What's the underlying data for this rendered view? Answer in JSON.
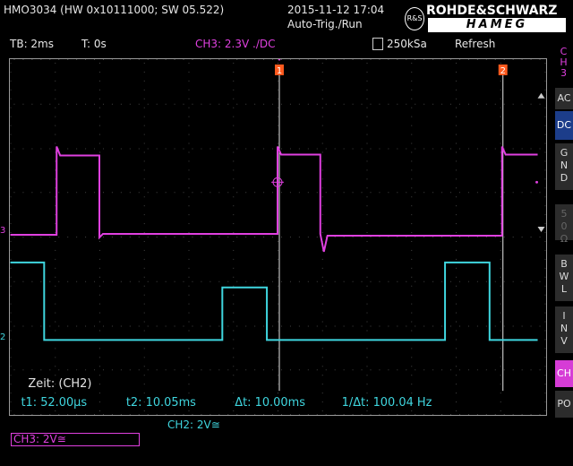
{
  "header": {
    "model": "HMO3034 (HW 0x10111000; SW 05.522)",
    "datetime": "2015-11-12 17:04",
    "trigger_mode": "Auto-Trig./Run",
    "logo_top": "ROHDE&SCHWARZ",
    "logo_bottom": "HAMEG",
    "logo_badge": "R&S"
  },
  "status": {
    "timebase": "TB: 2ms",
    "trigger_time": "T: 0s",
    "trigger_channel": "CH3: 2.3V ./DC",
    "sample_rate": "250kSa",
    "acquisition": "Refresh"
  },
  "side_menu": {
    "title_letters": [
      "C",
      "H",
      "3"
    ],
    "buttons": [
      {
        "label": "AC",
        "state": "normal"
      },
      {
        "label": "DC",
        "state": "active"
      },
      {
        "label": "GND",
        "state": "normal"
      },
      {
        "label": "50Ω",
        "state": "dim"
      },
      {
        "label": "BWL",
        "state": "normal"
      },
      {
        "label": "INV",
        "state": "normal"
      },
      {
        "label": "CH",
        "state": "ch3"
      },
      {
        "label": "PO",
        "state": "normal"
      }
    ]
  },
  "cursors": {
    "cursor1_label": "1",
    "cursor2_label": "2",
    "channel_marker_ch3": "3",
    "channel_marker_ch2": "2"
  },
  "measurements": {
    "title": "Zeit: (CH2)",
    "t1": "t1: 52.00µs",
    "t2": "t2: 10.05ms",
    "dt": "Δt: 10.00ms",
    "freq": "1/Δt: 100.04 Hz"
  },
  "footer": {
    "ch2_scale": "CH2: 2V≅",
    "ch3_scale": "CH3: 2V≅"
  },
  "colors": {
    "ch3": "#e040e0",
    "ch2": "#3fd6df",
    "grid": "#9a9a9a",
    "cursor": "#e8e8e8",
    "cursor_marker": "#ff5a1e",
    "active_button": "#1c3d8a"
  }
}
